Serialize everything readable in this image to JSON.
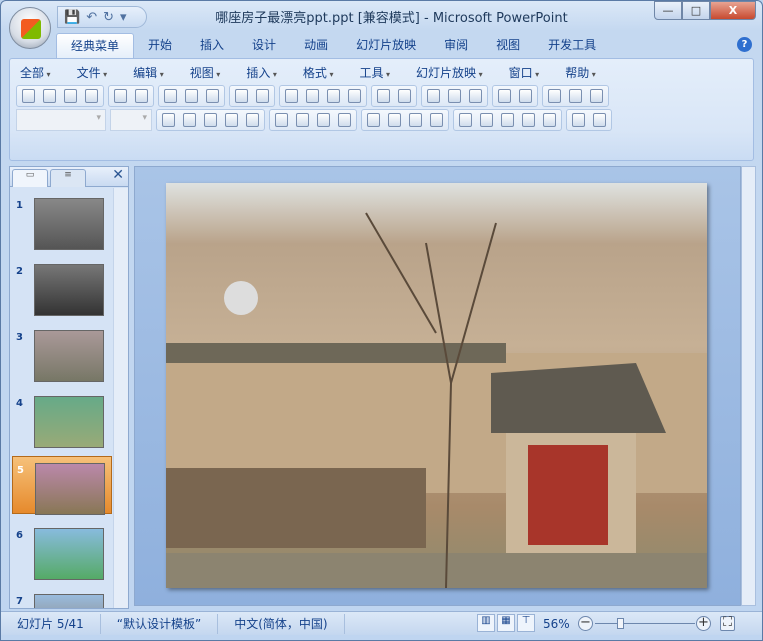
{
  "window": {
    "title": "哪座房子最漂亮ppt.ppt [兼容模式] - Microsoft PowerPoint",
    "min": "—",
    "max": "□",
    "close": "X"
  },
  "quick_access": {
    "save": "💾",
    "undo": "↶",
    "redo": "↻",
    "more": "▾"
  },
  "tabs": [
    "经典菜单",
    "开始",
    "插入",
    "设计",
    "动画",
    "幻灯片放映",
    "审阅",
    "视图",
    "开发工具"
  ],
  "active_tab": "经典菜单",
  "help": "?",
  "menu": [
    "全部",
    "文件",
    "编辑",
    "视图",
    "插入",
    "格式",
    "工具",
    "幻灯片放映",
    "窗口",
    "帮助"
  ],
  "toolbar1": [
    [
      "new-icon",
      "open-icon",
      "save-icon",
      "permission-icon"
    ],
    [
      "print-preview-icon",
      "attach-icon"
    ],
    [
      "print-icon",
      "preview-icon",
      "frame-icon"
    ],
    [
      "spelling-icon",
      "research-icon"
    ],
    [
      "cut-icon",
      "copy-icon",
      "paste-icon",
      "format-painter-icon"
    ],
    [
      "undo-icon",
      "redo-icon"
    ],
    [
      "chart-icon",
      "table-icon",
      "hyperlink-icon"
    ],
    [
      "color-icon",
      "grayscale-icon"
    ],
    [
      "new-slide-icon",
      "layout-icon",
      "textbox-icon"
    ]
  ],
  "toolbar2": [
    [
      "bold-icon",
      "italic-icon",
      "underline-icon",
      "shadow-icon",
      "change-case-icon"
    ],
    [
      "align-left-icon",
      "align-center-icon",
      "align-right-icon",
      "distribute-icon"
    ],
    [
      "line-spacing-icon",
      "text-direction-icon",
      "numbering-icon",
      "bullets-icon"
    ],
    [
      "font-color-icon",
      "grow-font-icon",
      "shrink-font-icon",
      "decrease-indent-icon",
      "increase-indent-icon"
    ],
    [
      "arrange-icon",
      "shapes-icon"
    ]
  ],
  "left_panel": {
    "close": "✕",
    "slides": [
      1,
      2,
      3,
      4,
      5,
      6,
      7
    ],
    "selected": 5
  },
  "thumb_colors": [
    [
      "#888",
      "#555"
    ],
    [
      "#777",
      "#333"
    ],
    [
      "#a99",
      "#776"
    ],
    [
      "#6a8",
      "#9a7"
    ],
    [
      "#b8a",
      "#875"
    ],
    [
      "#8bd",
      "#5a6"
    ],
    [
      "#9bd",
      "#876"
    ]
  ],
  "status": {
    "slide": "幻灯片 5/41",
    "template": "“默认设计模板”",
    "language": "中文(简体，中国)",
    "zoom": "56%",
    "zoom_out": "−",
    "zoom_in": "+"
  }
}
